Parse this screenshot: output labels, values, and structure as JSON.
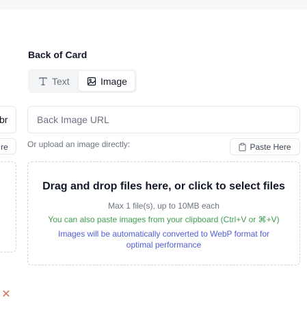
{
  "left_column": {
    "input_value_fragment": "br",
    "button_fragment": "re",
    "close_icon": "close-icon"
  },
  "back_of_card": {
    "title": "Back of Card",
    "tabs": [
      {
        "label": "Text",
        "icon": "text-type-icon",
        "active": false
      },
      {
        "label": "Image",
        "icon": "image-icon",
        "active": true
      }
    ],
    "url_input": {
      "placeholder": "Back Image URL",
      "value": ""
    },
    "upload_label": "Or upload an image directly:",
    "paste_button": {
      "label": "Paste Here",
      "icon": "clipboard-icon"
    },
    "dropzone": {
      "title": "Drag and drop files here, or click to select files",
      "limit": "Max 1 file(s), up to 10MB each",
      "clipboard_hint": "You can also paste images from your clipboard (Ctrl+V or ⌘+V)",
      "webp_note": "Images will be automatically converted to WebP format for optimal performance"
    }
  },
  "colors": {
    "success_text": "#3f9c4f",
    "info_text": "#4f5bd5",
    "danger_icon": "#dc6b5a"
  }
}
